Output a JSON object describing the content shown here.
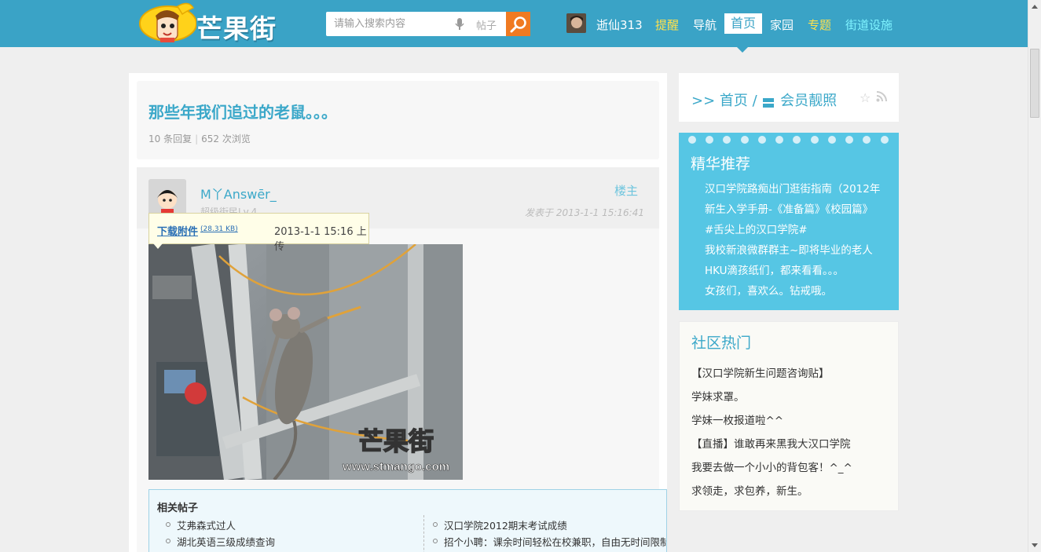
{
  "header": {
    "logo_text": "芒果街",
    "search_placeholder": "请输入搜索内容",
    "search_scope": "帖子",
    "username": "逝仙313",
    "nav": [
      "提醒",
      "导航",
      "首页",
      "家园",
      "专题",
      "街道设施"
    ]
  },
  "post": {
    "title": "那些年我们追过的老鼠。。。",
    "replies": "10 条回复",
    "views": "652 次浏览",
    "author": "M丫Answēr_",
    "rank": "超级街民Lv.4",
    "floor": "楼主",
    "time": "发表于 2013-1-1 15:16:41",
    "attachment": {
      "link_label": "下载附件",
      "size": "(28.31 KB)",
      "uploaded": "2013-1-1 15:16 上传"
    },
    "image_watermark": {
      "logo": "芒果街",
      "url": "www.stmango.com"
    }
  },
  "related": {
    "title": "相关帖子",
    "left": [
      "艾弗森式过人",
      "湖北英语三级成绩查询"
    ],
    "right": [
      "汉口学院2012期末考试成绩",
      "招个小聘：课余时间轻松在校兼职，自由无时间限制"
    ]
  },
  "sidebar": {
    "breadcrumb_prefix": ">> 首页 /",
    "breadcrumb_section": "会员靓照",
    "featured": {
      "title": "精华推荐",
      "items": [
        "汉口学院路痴出门逛街指南（2012年",
        "新生入学手册-《准备篇》《校园篇》",
        "#舌尖上的汉口学院#",
        "我校新浪微群群主~即将毕业的老人",
        "HKU滴孩纸们，都来看看。。。",
        "女孩们，喜欢么。钻戒哦。"
      ]
    },
    "hot": {
      "title": "社区热门",
      "items": [
        "【汉口学院新生问题咨询贴】",
        "学妹求罩。",
        "学妹一枚报道啦^^",
        "【直播】谁敢再来黑我大汉口学院",
        "我要去做一个小小的背包客！^_^",
        "求领走，求包养，新生。"
      ]
    }
  },
  "colors": {
    "topbar": "#3aa3c6",
    "accent": "#3ba8c9",
    "featured_bg": "#56c6e4",
    "search_button": "#f07a21",
    "nav_highlight": "#ffe14d",
    "nav_special": "#7ff3ff"
  }
}
